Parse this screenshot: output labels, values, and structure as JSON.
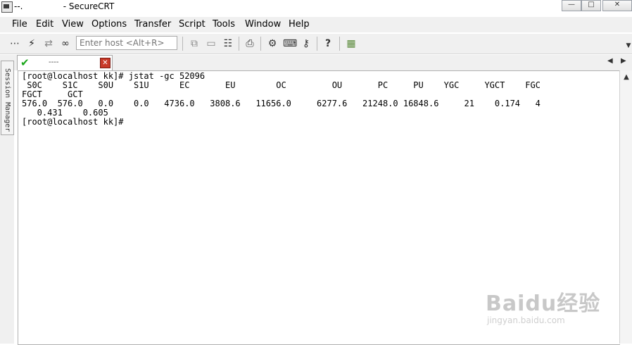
{
  "window": {
    "title": "SecureCRT",
    "title_prefix": "--.",
    "controls": [
      "minimize",
      "maximize",
      "close"
    ]
  },
  "menu": [
    "File",
    "Edit",
    "View",
    "Options",
    "Transfer",
    "Script",
    "Tools",
    "Window",
    "Help"
  ],
  "toolbar": {
    "host_placeholder": "Enter host <Alt+R>",
    "icons": [
      "connect-bar-icon",
      "quick-connect-icon",
      "reconnect-icon",
      "disconnect-icon",
      "copy-icon",
      "paste-icon",
      "find-icon",
      "print-icon",
      "settings-icon",
      "keymap-icon",
      "key-icon",
      "help-icon",
      "sftp-icon"
    ]
  },
  "sidebar": {
    "label": "Session Manager"
  },
  "tab": {
    "label": "----",
    "status": "connected"
  },
  "terminal": {
    "lines": [
      "[root@localhost kk]# jstat -gc 52096",
      " S0C    S1C    S0U    S1U      EC       EU        OC         OU       PC     PU    YGC     YGCT    FGC",
      "FGCT     GCT",
      "576.0  576.0   0.0    0.0   4736.0   3808.6   11656.0     6277.6   21248.0 16848.6     21    0.174   4",
      "   0.431    0.605",
      "[root@localhost kk]#"
    ]
  },
  "watermark": {
    "text": "Baidu经验",
    "sub": "jingyan.baidu.com"
  },
  "colors": {
    "check": "#1aa61a",
    "close": "#c83a2a",
    "menubar": "#f0f0f0"
  }
}
